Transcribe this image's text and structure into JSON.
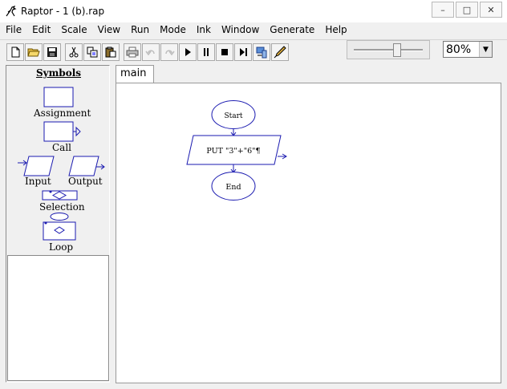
{
  "window": {
    "title": "Raptor - 1 (b).rap",
    "minimize_glyph": "–",
    "maximize_glyph": "□",
    "close_glyph": "✕"
  },
  "menu": [
    "File",
    "Edit",
    "Scale",
    "View",
    "Run",
    "Mode",
    "Ink",
    "Window",
    "Generate",
    "Help"
  ],
  "toolbar": {
    "buttons": [
      "new-file-icon",
      "open-folder-icon",
      "save-icon",
      "cut-icon",
      "copy-icon",
      "paste-icon",
      "print-icon",
      "undo-icon",
      "redo-icon",
      "play-icon",
      "pause-icon",
      "stop-icon",
      "step-icon",
      "test-server-icon",
      "ink-pen-icon"
    ],
    "zoom_value": "80%",
    "speed_level": 0.63
  },
  "symbols": {
    "heading": "Symbols",
    "assignment": "Assignment",
    "call": "Call",
    "input": "Input",
    "output": "Output",
    "selection": "Selection",
    "loop": "Loop"
  },
  "tab": {
    "label": "main"
  },
  "flowchart": {
    "start": "Start",
    "output_stmt": "PUT \"3\"+\"6\"¶",
    "end": "End"
  },
  "colors": {
    "flow_blue": "#1a1ab0",
    "window_bg": "#f0f0f0"
  }
}
